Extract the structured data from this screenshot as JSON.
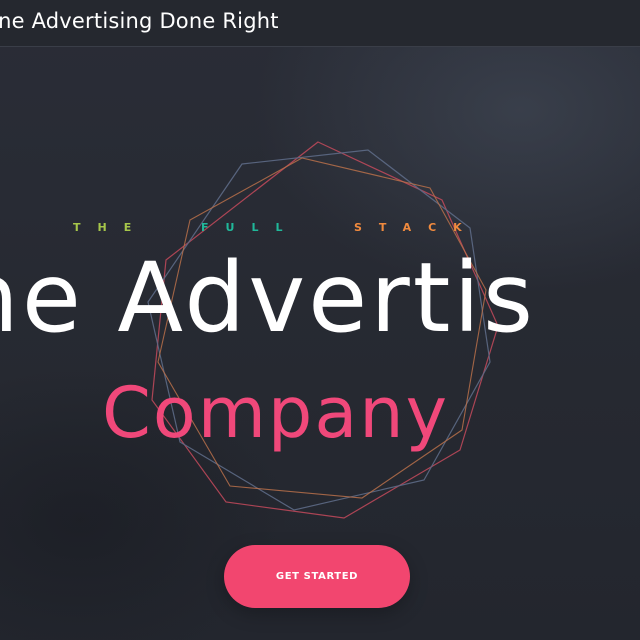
{
  "header": {
    "site_title": "line Advertising Done Right"
  },
  "hero": {
    "tagline": [
      {
        "text": "THE",
        "color": "#a6c64a"
      },
      {
        "text": "FULL",
        "color": "#20b89a"
      },
      {
        "text": "STACK",
        "color": "#f08a3e"
      }
    ],
    "headline": "ne Advertis",
    "subline": "Company",
    "cta_label": "GET STARTED"
  },
  "colors": {
    "background": "#272a34",
    "accent": "#f2466f",
    "subline": "#f0487a",
    "geo_red": "#c44a5c",
    "geo_orange": "#b8704a",
    "geo_blue": "#5d6a86"
  }
}
